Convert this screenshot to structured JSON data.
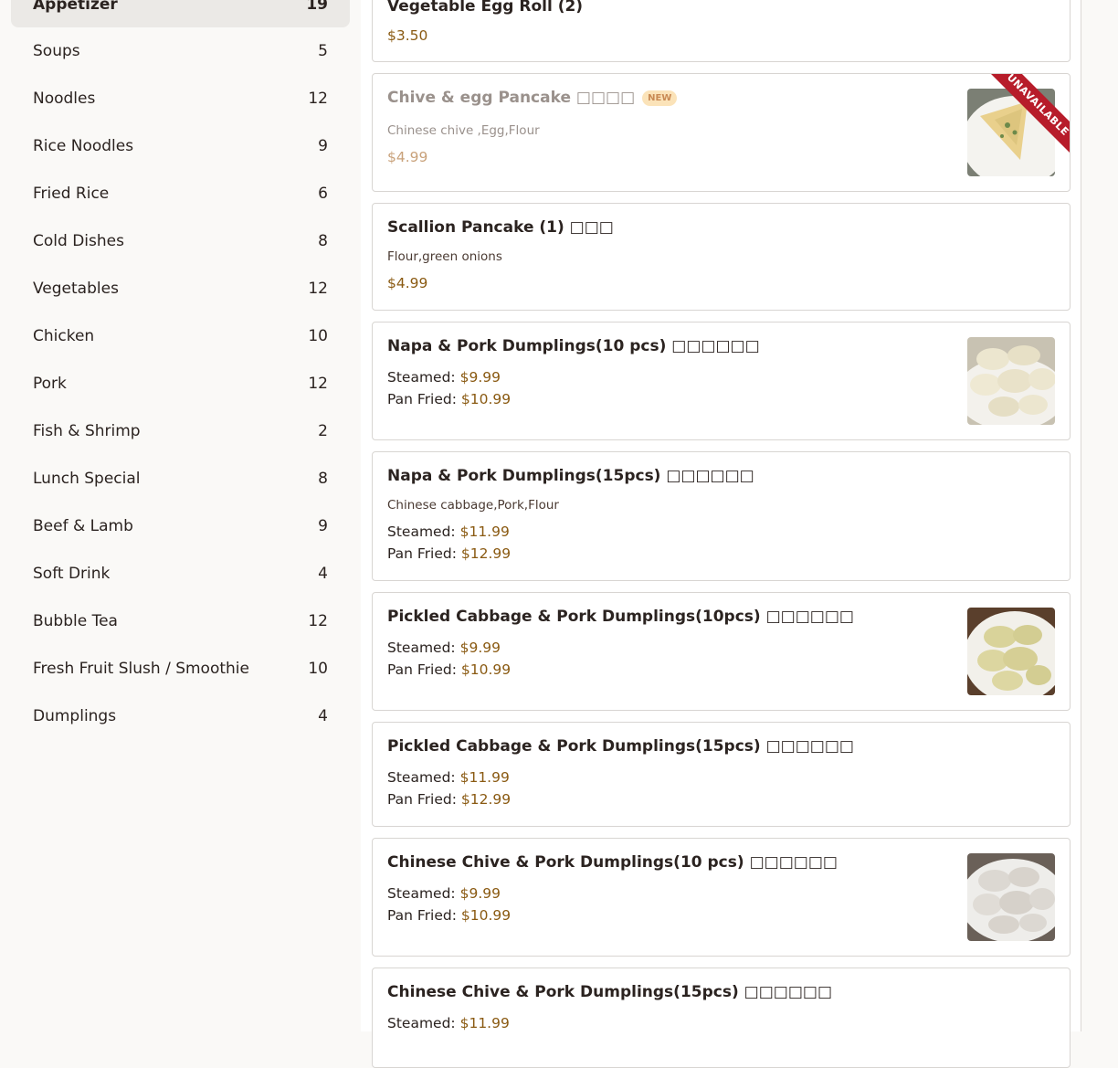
{
  "categories": [
    {
      "name": "Appetizer",
      "count": "19"
    },
    {
      "name": "Soups",
      "count": "5"
    },
    {
      "name": "Noodles",
      "count": "12"
    },
    {
      "name": "Rice Noodles",
      "count": "9"
    },
    {
      "name": "Fried Rice",
      "count": "6"
    },
    {
      "name": "Cold Dishes",
      "count": "8"
    },
    {
      "name": "Vegetables",
      "count": "12"
    },
    {
      "name": "Chicken",
      "count": "10"
    },
    {
      "name": "Pork",
      "count": "12"
    },
    {
      "name": "Fish & Shrimp",
      "count": "2"
    },
    {
      "name": "Lunch Special",
      "count": "8"
    },
    {
      "name": "Beef & Lamb",
      "count": "9"
    },
    {
      "name": "Soft Drink",
      "count": "4"
    },
    {
      "name": "Bubble Tea",
      "count": "12"
    },
    {
      "name": "Fresh Fruit Slush / Smoothie",
      "count": "10"
    },
    {
      "name": "Dumplings",
      "count": "4"
    }
  ],
  "items": [
    {
      "title": "Vegetable Egg Roll (2)",
      "price": "$3.50"
    },
    {
      "title": "Chive & egg Pancake □□□□",
      "badge": "NEW",
      "desc": "Chinese chive ,Egg,Flour",
      "price": "$4.99",
      "status": "UNAVAILABLE"
    },
    {
      "title": "Scallion Pancake (1) □□□",
      "desc": "Flour,green onions",
      "price": "$4.99"
    },
    {
      "title": "Napa & Pork Dumplings(10 pcs) □□□□□□",
      "steamed_label": "Steamed:",
      "steamed": "$9.99",
      "fried_label": "Pan Fried:",
      "fried": "$10.99"
    },
    {
      "title": "Napa & Pork Dumplings(15pcs) □□□□□□",
      "desc": "Chinese cabbage,Pork,Flour",
      "steamed_label": "Steamed:",
      "steamed": "$11.99",
      "fried_label": "Pan Fried:",
      "fried": "$12.99"
    },
    {
      "title": "Pickled Cabbage & Pork Dumplings(10pcs) □□□□□□",
      "steamed_label": "Steamed:",
      "steamed": "$9.99",
      "fried_label": "Pan Fried:",
      "fried": "$10.99"
    },
    {
      "title": "Pickled Cabbage & Pork Dumplings(15pcs) □□□□□□",
      "steamed_label": "Steamed:",
      "steamed": "$11.99",
      "fried_label": "Pan Fried:",
      "fried": "$12.99"
    },
    {
      "title": "Chinese Chive & Pork Dumplings(10 pcs) □□□□□□",
      "steamed_label": "Steamed:",
      "steamed": "$9.99",
      "fried_label": "Pan Fried:",
      "fried": "$10.99"
    },
    {
      "title": "Chinese Chive & Pork Dumplings(15pcs) □□□□□□",
      "steamed_label": "Steamed:",
      "steamed": "$11.99"
    }
  ],
  "colors": {
    "accent_price": "#8a5a12",
    "ribbon": "#b71c2a",
    "active_category_bg": "#ebe9e6"
  }
}
